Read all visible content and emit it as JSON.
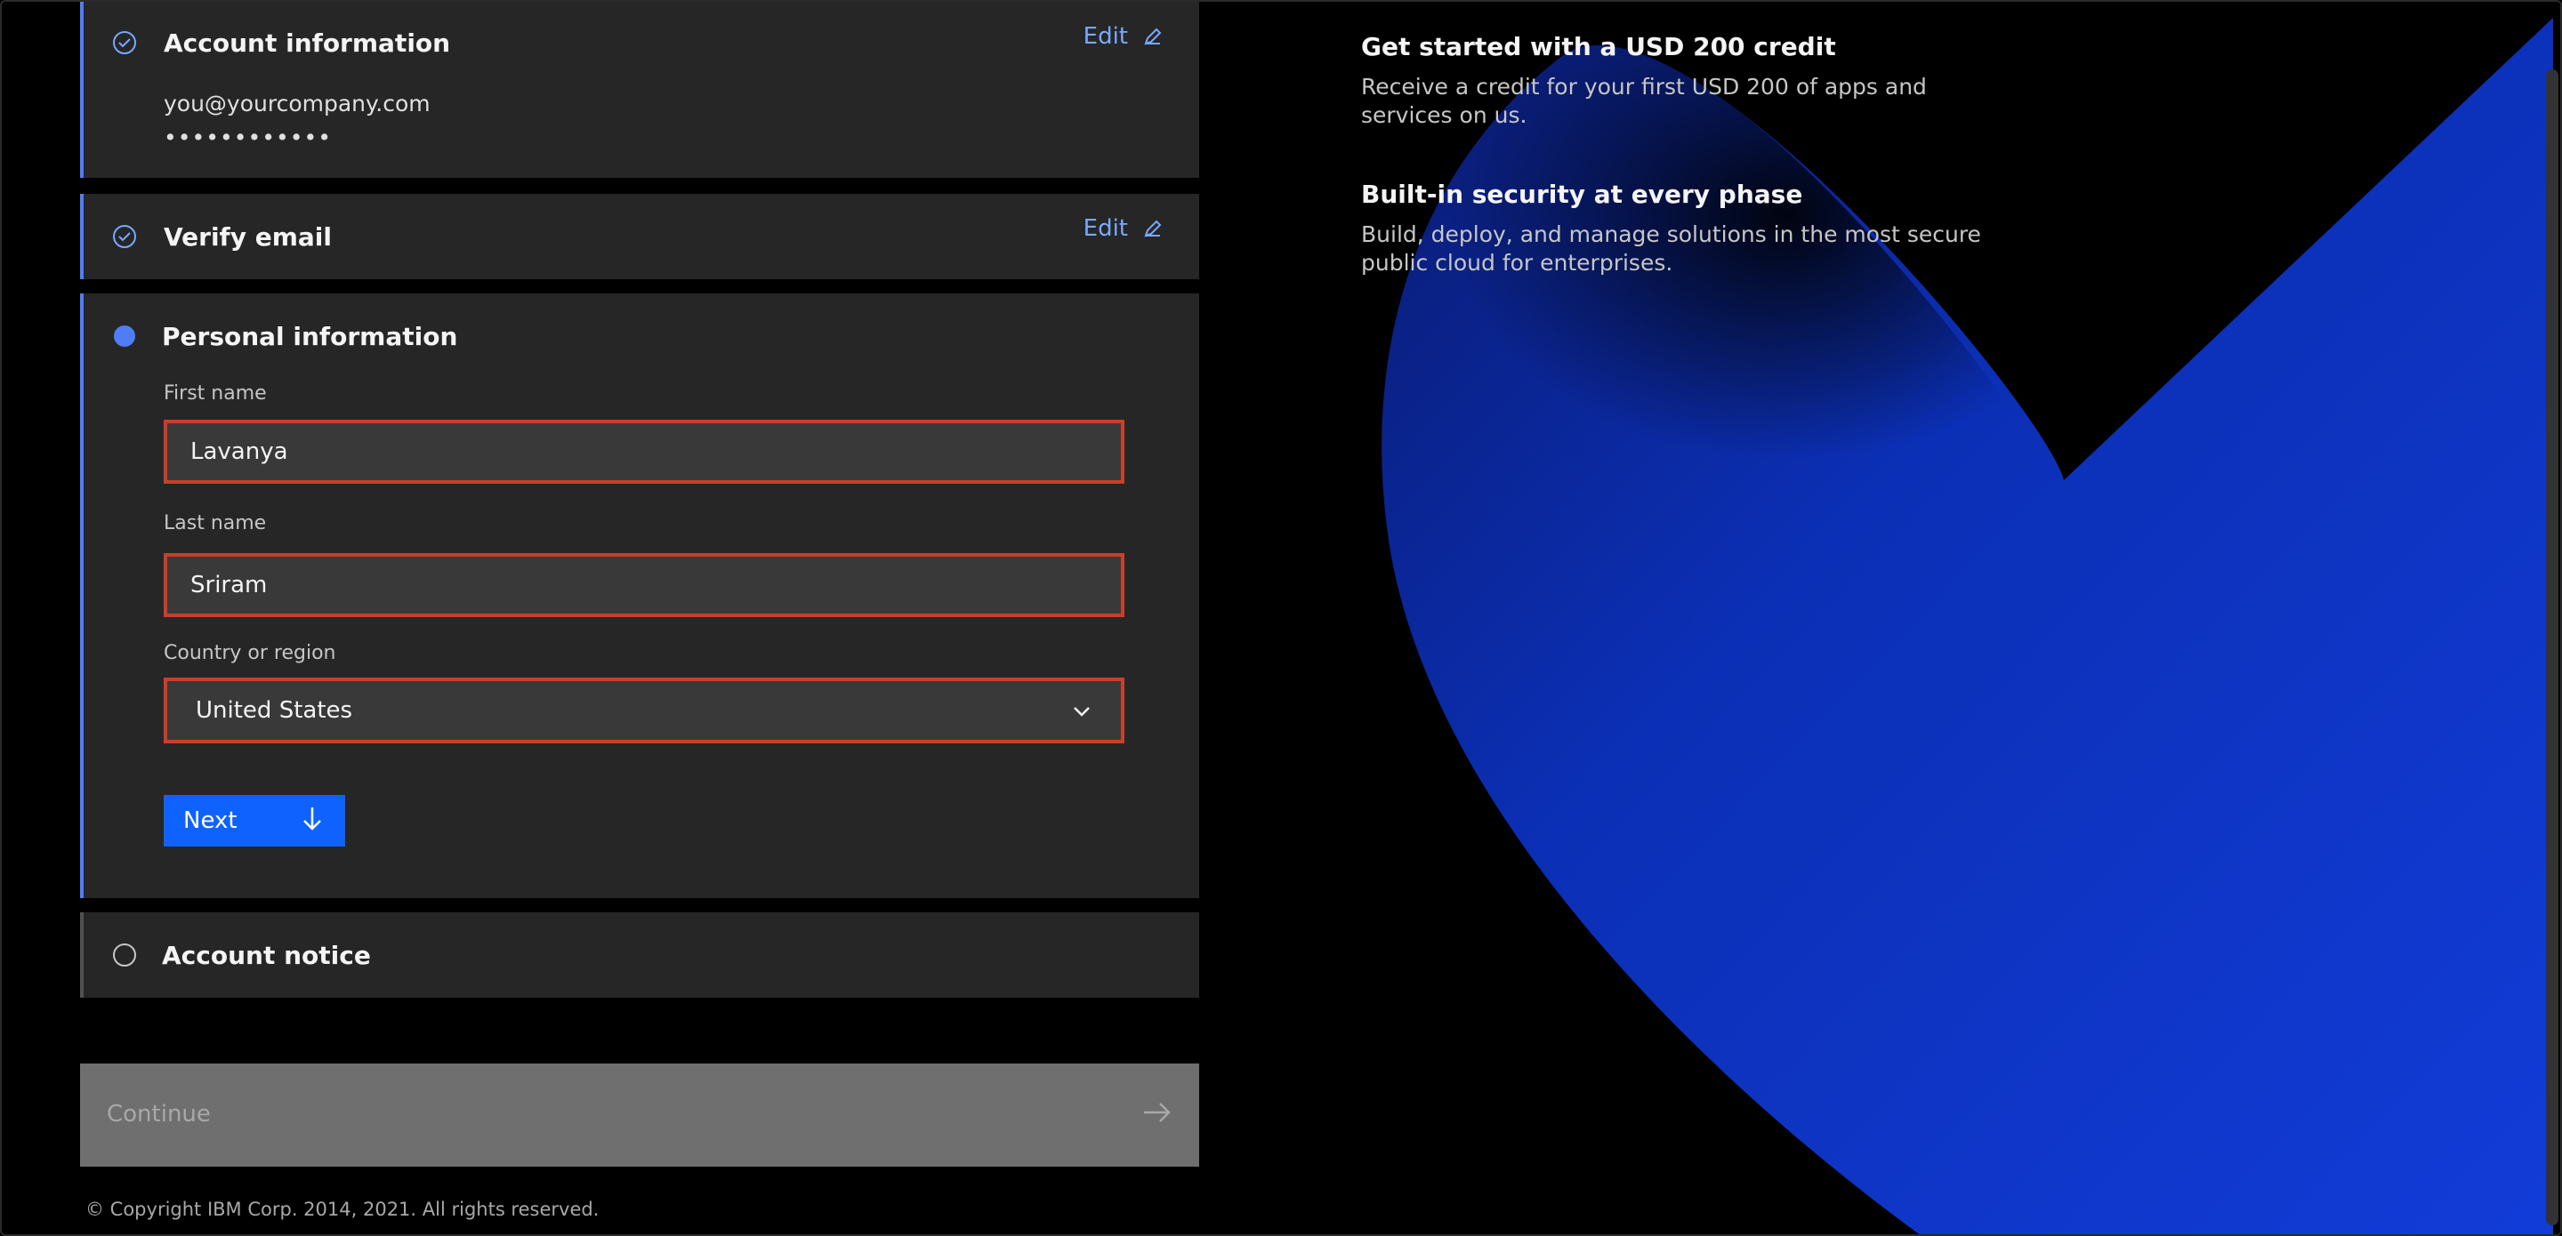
{
  "colors": {
    "accent": "#0f62fe",
    "link": "#78a9ff",
    "error": "#c8402a",
    "panel": "#262626",
    "active_step": "#4f7df5"
  },
  "steps": {
    "account": {
      "title": "Account information",
      "edit_label": "Edit",
      "email": "you@yourcompany.com",
      "password_mask": "••••••••••••",
      "icon": "check-circle-icon"
    },
    "verify": {
      "title": "Verify email",
      "edit_label": "Edit",
      "icon": "check-circle-icon"
    },
    "personal": {
      "title": "Personal information",
      "icon": "filled-dot-icon",
      "first_name_label": "First name",
      "first_name_value": "Lavanya",
      "last_name_label": "Last name",
      "last_name_value": "Sriram",
      "country_label": "Country or region",
      "country_value": "United States",
      "next_label": "Next"
    },
    "notice": {
      "title": "Account notice",
      "icon": "empty-circle-icon"
    }
  },
  "continue_label": "Continue",
  "copyright": "© Copyright IBM Corp. 2014, 2021. All rights reserved.",
  "features": [
    {
      "title": "Get started with a USD 200 credit",
      "desc": "Receive a credit for your first USD 200 of apps and services on us."
    },
    {
      "title": "Built-in security at every phase",
      "desc": "Build, deploy, and manage solutions in the most secure public cloud for enterprises."
    }
  ]
}
